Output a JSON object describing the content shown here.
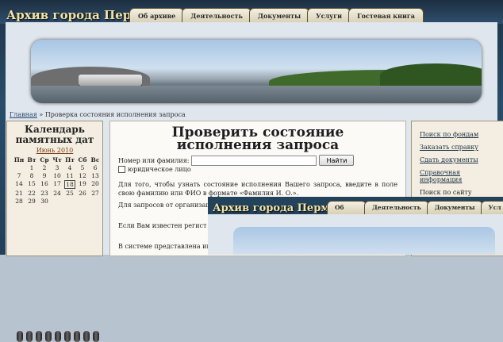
{
  "site": {
    "logo": "Архив города Перми",
    "tabs": [
      "Об архиве",
      "Деятельность",
      "Документы",
      "Услуги",
      "Гостевая книга"
    ]
  },
  "breadcrumb": {
    "home": "Главная",
    "separator": "»",
    "current": "Проверка состояния исполнения запроса"
  },
  "calendar": {
    "title": "Календарь памятных дат",
    "month": "Июнь 2010",
    "weekdays": [
      "Пн",
      "Вт",
      "Ср",
      "Чт",
      "Пт",
      "Сб",
      "Вс"
    ],
    "days": [
      "",
      "1",
      "2",
      "3",
      "4",
      "5",
      "6",
      "7",
      "8",
      "9",
      "10",
      "11",
      "12",
      "13",
      "14",
      "15",
      "16",
      "17",
      "18",
      "19",
      "20",
      "21",
      "22",
      "23",
      "24",
      "25",
      "26",
      "27",
      "28",
      "29",
      "30",
      "",
      "",
      "",
      "",
      ""
    ],
    "today": "18"
  },
  "main": {
    "title": "Проверить состояние исполнения запроса",
    "name_label": "Номер или фамилия:",
    "name_value": "",
    "find_button": "Найти",
    "legal_checkbox_label": "юридическое лицо",
    "para1": "Для того, чтобы узнать состояние исполнения Вашего запроса, введите в поле свою фамилию или ФИО в формате «Фамилия И. О.».",
    "para2": "Для запросов от организаций «юридическое лицо».",
    "para3": "Если Вам известен регист фамилии.",
    "para4": "В системе представлена ин"
  },
  "sidebar": {
    "links": [
      "Поиск по фондам",
      "Заказать справку",
      "Сдать документы",
      "Справочная информация",
      "Поиск по сайту"
    ]
  },
  "overlay_window": {
    "logo": "Архив города Перми",
    "tabs": [
      "Об архиве",
      "Деятельность",
      "Документы",
      "Усл"
    ]
  }
}
